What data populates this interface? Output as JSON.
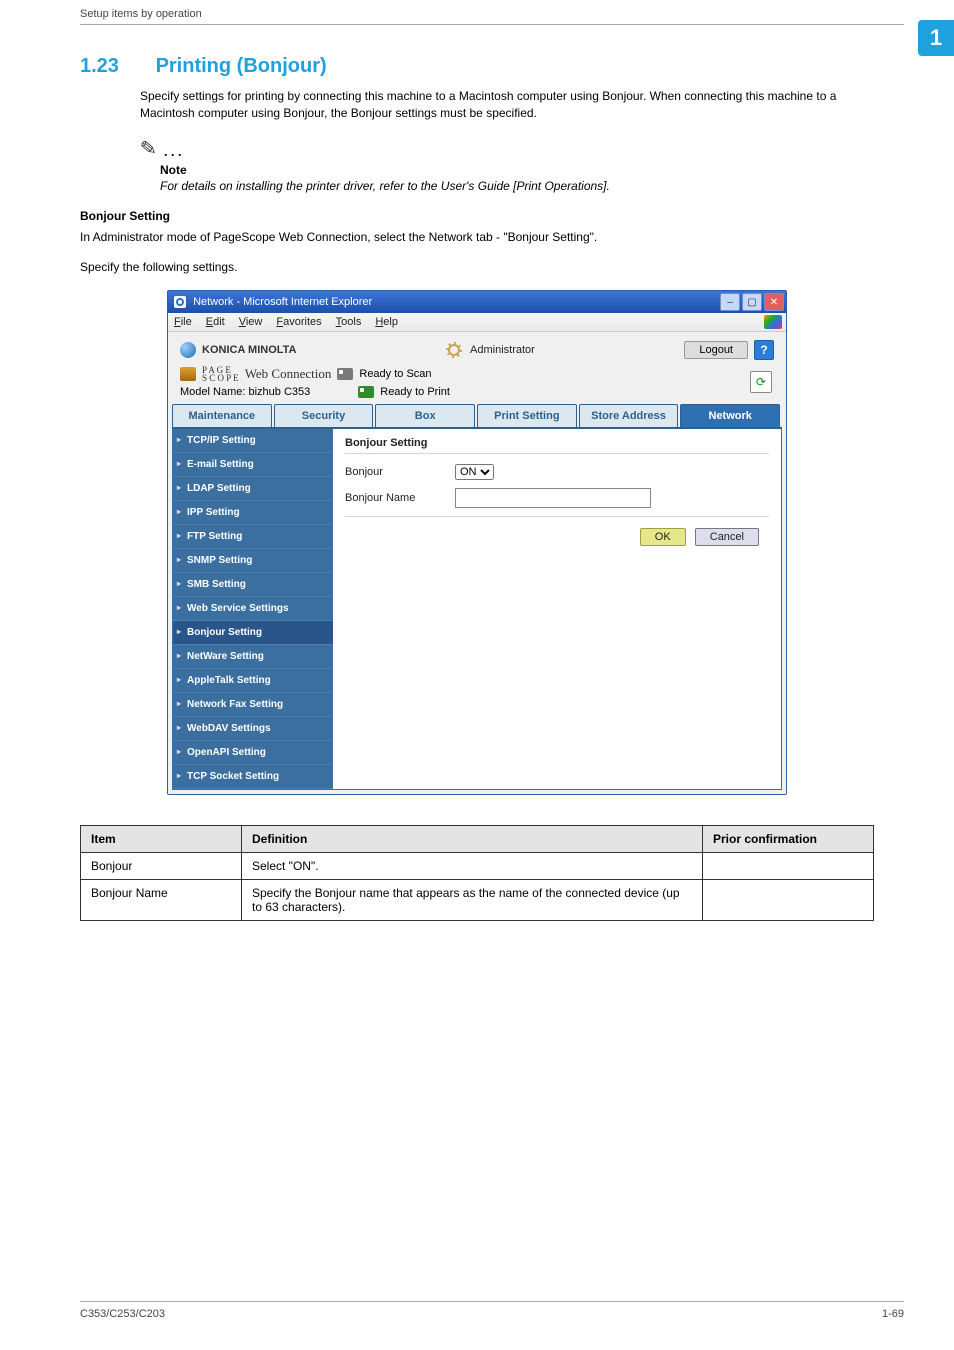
{
  "header": {
    "running": "Setup items by operation",
    "chapter_badge": "1"
  },
  "section": {
    "number": "1.23",
    "title": "Printing (Bonjour)",
    "intro": "Specify settings for printing by connecting this machine to a Macintosh computer using Bonjour. When connecting this machine to a Macintosh computer using Bonjour, the Bonjour settings must be specified.",
    "note_label": "Note",
    "note_body": "For details on installing the printer driver, refer to the User's Guide [Print Operations].",
    "sub_heading": "Bonjour Setting",
    "sub_para1": "In Administrator mode of PageScope Web Connection, select the Network tab - \"Bonjour Setting\".",
    "sub_para2": "Specify the following settings."
  },
  "shot": {
    "window_title": "Network - Microsoft Internet Explorer",
    "menu": [
      {
        "u": "F",
        "r": "ile"
      },
      {
        "u": "E",
        "r": "dit"
      },
      {
        "u": "V",
        "r": "iew"
      },
      {
        "u": "F",
        "r": "avorites"
      },
      {
        "u": "T",
        "r": "ools"
      },
      {
        "u": "H",
        "r": "elp"
      }
    ],
    "brand": "KONICA MINOLTA",
    "mode": "Administrator",
    "logout": "Logout",
    "product": "Web Connection",
    "status_scan": "Ready to Scan",
    "status_print": "Ready to Print",
    "model": "Model Name: bizhub C353",
    "tabs": [
      "Maintenance",
      "Security",
      "Box",
      "Print Setting",
      "Store Address",
      "Network"
    ],
    "sidebar": [
      "TCP/IP Setting",
      "E-mail Setting",
      "LDAP Setting",
      "IPP Setting",
      "FTP Setting",
      "SNMP Setting",
      "SMB Setting",
      "Web Service Settings",
      "Bonjour Setting",
      "NetWare Setting",
      "AppleTalk Setting",
      "Network Fax Setting",
      "WebDAV Settings",
      "OpenAPI Setting",
      "TCP Socket Setting"
    ],
    "panel": {
      "heading": "Bonjour Setting",
      "row1_label": "Bonjour",
      "row1_value": "ON",
      "row2_label": "Bonjour Name",
      "row2_value": "",
      "ok": "OK",
      "cancel": "Cancel"
    }
  },
  "table": {
    "headers": [
      "Item",
      "Definition",
      "Prior confirmation"
    ],
    "rows": [
      {
        "item": "Bonjour",
        "definition": "Select \"ON\".",
        "prior": ""
      },
      {
        "item": "Bonjour Name",
        "definition": "Specify the Bonjour name that appears as the name of the connected device (up to 63 characters).",
        "prior": ""
      }
    ]
  },
  "footer": {
    "left": "C353/C253/C203",
    "right": "1-69"
  }
}
